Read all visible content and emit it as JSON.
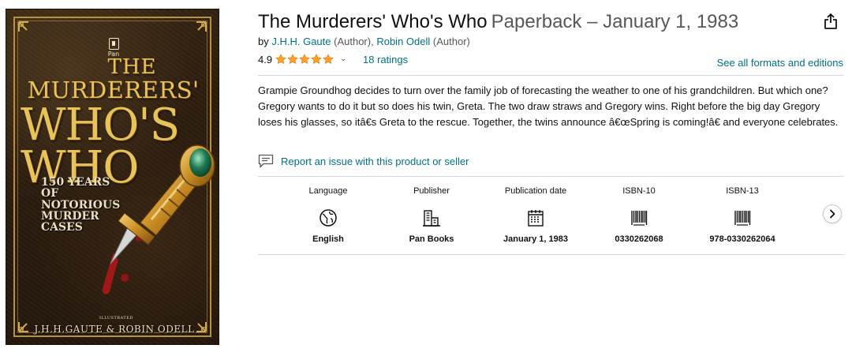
{
  "product": {
    "title": "The Murderers' Who's Who",
    "binding": "Paperback – January 1, 1983",
    "by_prefix": "by",
    "authors": [
      {
        "name": "J.H.H. Gaute",
        "role": "(Author),"
      },
      {
        "name": "Robin Odell",
        "role": "(Author)"
      }
    ],
    "rating_value": "4.9",
    "stars_filled": 5,
    "ratings_count": "18 ratings",
    "see_formats": "See all formats and editions",
    "description": "Grampie Groundhog decides to turn over the family job of forecasting the weather to one of his grandchildren. But which one? Gregory wants to do it but so does his twin, Greta. The two draw straws and Gregory wins. Right before the big day Gregory loses his glasses, so itâ€s Greta to the rescue. Together, the twins announce â€œSpring is coming!â€ and everyone celebrates.",
    "report_link": "Report an issue with this product or seller"
  },
  "details": [
    {
      "label": "Language",
      "icon": "globe-icon",
      "value": "English"
    },
    {
      "label": "Publisher",
      "icon": "building-icon",
      "value": "Pan Books"
    },
    {
      "label": "Publication date",
      "icon": "calendar-icon",
      "value": "January 1, 1983"
    },
    {
      "label": "ISBN-10",
      "icon": "barcode-icon",
      "value": "0330262068"
    },
    {
      "label": "ISBN-13",
      "icon": "barcode-icon",
      "value": "978-0330262064"
    }
  ],
  "cover": {
    "publisher_mark": "Pan",
    "title_lines": [
      "THE",
      "MURDERERS'",
      "WHO'S",
      "WHO"
    ],
    "subtitle_lines": [
      "150 YEARS",
      "OF NOTORIOUS",
      "MURDER",
      "CASES"
    ],
    "illustrated_label": "ILLUSTRATED",
    "authors_line": "J.H.H.GAUTE & ROBIN ODELL"
  },
  "colors": {
    "link": "#007185",
    "star": "#ffa41c",
    "text": "#0f1111",
    "muted": "#565959",
    "divider": "#d5d9d9",
    "cover_gold": "#e8c35a"
  }
}
